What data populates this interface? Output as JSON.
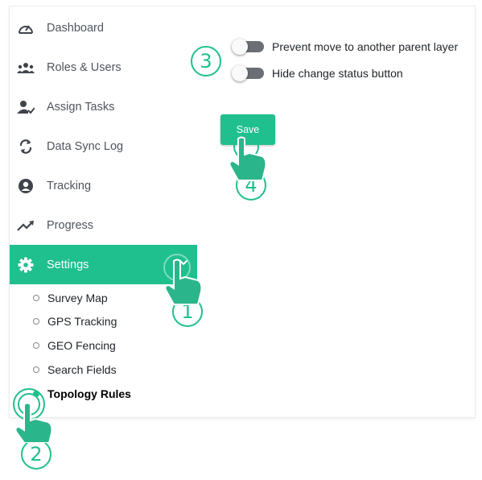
{
  "sidebar": {
    "items": [
      {
        "label": "Dashboard",
        "icon": "gauge-icon"
      },
      {
        "label": "Roles & Users",
        "icon": "users-icon"
      },
      {
        "label": "Assign Tasks",
        "icon": "user-check-icon"
      },
      {
        "label": "Data Sync Log",
        "icon": "sync-icon"
      },
      {
        "label": "Tracking",
        "icon": "person-circle-icon"
      },
      {
        "label": "Progress",
        "icon": "trending-up-icon"
      },
      {
        "label": "Settings",
        "icon": "gear-icon",
        "active": true
      }
    ],
    "settings_sub": [
      {
        "label": "Survey Map"
      },
      {
        "label": "GPS Tracking"
      },
      {
        "label": "GEO Fencing"
      },
      {
        "label": "Search Fields"
      },
      {
        "label": "Topology Rules",
        "current": true
      }
    ]
  },
  "content": {
    "toggles": [
      {
        "label": "Prevent move to another parent layer",
        "on": false
      },
      {
        "label": "Hide change status button",
        "on": false
      }
    ],
    "save_label": "Save"
  },
  "steps": [
    "1",
    "2",
    "3",
    "4"
  ],
  "colors": {
    "accent": "#1fc08e",
    "toggle_off": "#6b6f75",
    "text": "#4f555d"
  }
}
